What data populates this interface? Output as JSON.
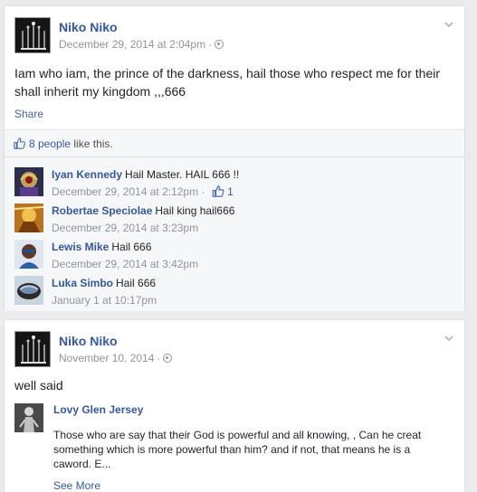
{
  "post1": {
    "author": "Niko Niko",
    "timestamp": "December 29, 2014 at 2:04pm",
    "separator": "·",
    "text": "Iam who iam, the prince of the darkness, hail those who respect me for their shall inherit my kingdom ,,,666",
    "share_label": "Share",
    "likes_count": "8 people",
    "likes_suffix": "like this.",
    "comments": [
      {
        "name": "Iyan Kennedy",
        "text": "Hail Master. HAIL 666 !!",
        "time": "December 29, 2014 at 2:12pm",
        "sep": "·",
        "likes": "1"
      },
      {
        "name": "Robertae Speciolae",
        "text": "Hail king hail666",
        "time": "December 29, 2014 at 3:23pm"
      },
      {
        "name": "Lewis Mike",
        "text": "Hail 666",
        "time": "December 29, 2014 at 3:42pm"
      },
      {
        "name": "Luka Simbo",
        "text": "Hail 666",
        "time": "January 1 at 10:17pm"
      }
    ]
  },
  "post2": {
    "author": "Niko Niko",
    "timestamp": "November 10, 2014",
    "separator": "·",
    "text": "well said",
    "reply": {
      "name": "Lovy Glen Jersey",
      "text": "Those who are say that their God is powerful and all knowing, , Can he creat something which is more powerful than him? and if not, that means he is a caword. E...",
      "see_more": "See More"
    }
  },
  "colors": {
    "link": "#365899",
    "meta": "#90949c",
    "background": "#e9ebee",
    "comment_bg": "#f6f7f9"
  },
  "icons": [
    "chevron-down-icon",
    "globe-icon",
    "thumbs-up-icon"
  ]
}
